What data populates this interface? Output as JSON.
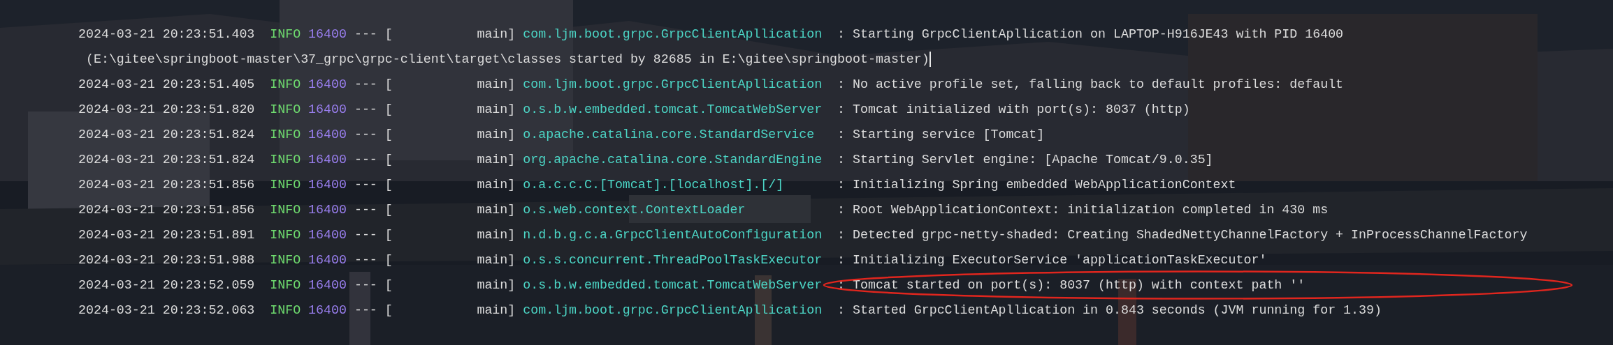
{
  "log_lines": [
    {
      "kind": "log",
      "timestamp": "2024-03-21 20:23:51.403",
      "level": "INFO",
      "pid": "16400",
      "separator": "---",
      "thread": "[           main]",
      "logger": "com.ljm.boot.grpc.GrpcClientApllication",
      "message": ": Starting GrpcClientApllication on LAPTOP-H916JE43 with PID 16400",
      "highlighted": false
    },
    {
      "kind": "continuation",
      "message": "(E:\\gitee\\springboot-master\\37_grpc\\grpc-client\\target\\classes started by 82685 in E:\\gitee\\springboot-master)",
      "cursor": true
    },
    {
      "kind": "log",
      "timestamp": "2024-03-21 20:23:51.405",
      "level": "INFO",
      "pid": "16400",
      "separator": "---",
      "thread": "[           main]",
      "logger": "com.ljm.boot.grpc.GrpcClientApllication",
      "message": ": No active profile set, falling back to default profiles: default",
      "highlighted": false
    },
    {
      "kind": "log",
      "timestamp": "2024-03-21 20:23:51.820",
      "level": "INFO",
      "pid": "16400",
      "separator": "---",
      "thread": "[           main]",
      "logger": "o.s.b.w.embedded.tomcat.TomcatWebServer",
      "message": ": Tomcat initialized with port(s): 8037 (http)",
      "highlighted": false
    },
    {
      "kind": "log",
      "timestamp": "2024-03-21 20:23:51.824",
      "level": "INFO",
      "pid": "16400",
      "separator": "---",
      "thread": "[           main]",
      "logger": "o.apache.catalina.core.StandardService",
      "message": ": Starting service [Tomcat]",
      "highlighted": false
    },
    {
      "kind": "log",
      "timestamp": "2024-03-21 20:23:51.824",
      "level": "INFO",
      "pid": "16400",
      "separator": "---",
      "thread": "[           main]",
      "logger": "org.apache.catalina.core.StandardEngine",
      "message": ": Starting Servlet engine: [Apache Tomcat/9.0.35]",
      "highlighted": false
    },
    {
      "kind": "log",
      "timestamp": "2024-03-21 20:23:51.856",
      "level": "INFO",
      "pid": "16400",
      "separator": "---",
      "thread": "[           main]",
      "logger": "o.a.c.c.C.[Tomcat].[localhost].[/]",
      "message": ": Initializing Spring embedded WebApplicationContext",
      "highlighted": false
    },
    {
      "kind": "log",
      "timestamp": "2024-03-21 20:23:51.856",
      "level": "INFO",
      "pid": "16400",
      "separator": "---",
      "thread": "[           main]",
      "logger": "o.s.web.context.ContextLoader",
      "message": ": Root WebApplicationContext: initialization completed in 430 ms",
      "highlighted": false
    },
    {
      "kind": "log",
      "timestamp": "2024-03-21 20:23:51.891",
      "level": "INFO",
      "pid": "16400",
      "separator": "---",
      "thread": "[           main]",
      "logger": "n.d.b.g.c.a.GrpcClientAutoConfiguration",
      "message": ": Detected grpc-netty-shaded: Creating ShadedNettyChannelFactory + InProcessChannelFactory",
      "highlighted": false
    },
    {
      "kind": "log",
      "timestamp": "2024-03-21 20:23:51.988",
      "level": "INFO",
      "pid": "16400",
      "separator": "---",
      "thread": "[           main]",
      "logger": "o.s.s.concurrent.ThreadPoolTaskExecutor",
      "message": ": Initializing ExecutorService 'applicationTaskExecutor'",
      "highlighted": false
    },
    {
      "kind": "log",
      "timestamp": "2024-03-21 20:23:52.059",
      "level": "INFO",
      "pid": "16400",
      "separator": "---",
      "thread": "[           main]",
      "logger": "o.s.b.w.embedded.tomcat.TomcatWebServer",
      "message": ": Tomcat started on port(s): 8037 (http) with context path ''",
      "highlighted": true
    },
    {
      "kind": "log",
      "timestamp": "2024-03-21 20:23:52.063",
      "level": "INFO",
      "pid": "16400",
      "separator": "---",
      "thread": "[           main]",
      "logger": "com.ljm.boot.grpc.GrpcClientApllication",
      "message": ": Started GrpcClientApllication in 0.843 seconds (JVM running for 1.39)",
      "highlighted": false
    }
  ]
}
